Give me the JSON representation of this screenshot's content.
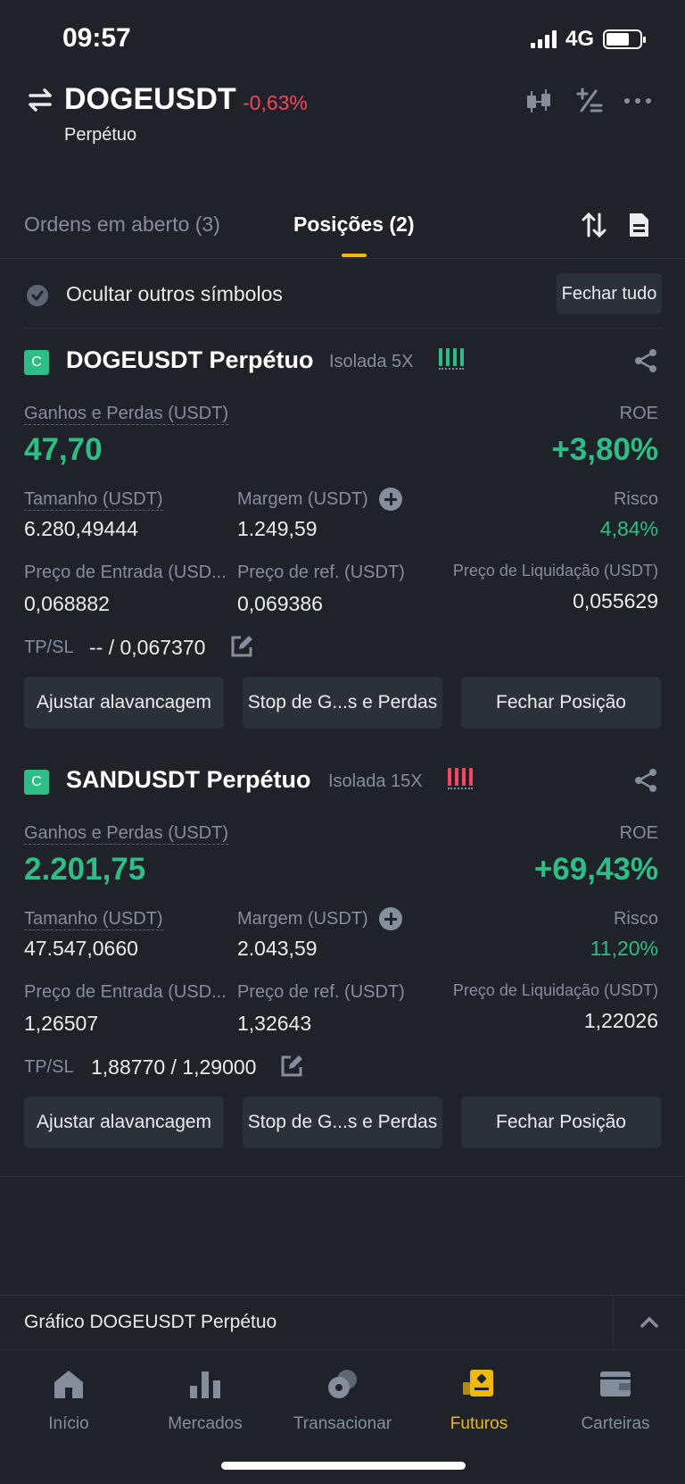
{
  "status_bar": {
    "time": "09:57",
    "network": "4G"
  },
  "header": {
    "symbol": "DOGEUSDT",
    "change": "-0,63%",
    "subtitle": "Perpétuo",
    "icons": [
      "candlestick-icon",
      "calculator-icon",
      "more-icon"
    ]
  },
  "tabs": [
    {
      "label": "Ordens em aberto (3)",
      "active": false
    },
    {
      "label": "Posições (2)",
      "active": true
    }
  ],
  "filter": {
    "label": "Ocultar outros símbolos",
    "close_all": "Fechar tudo"
  },
  "positions": [
    {
      "badge": "C",
      "title": "DOGEUSDT Perpétuo",
      "margin_mode": "Isolada 5X",
      "risk_color": "#2ebd85",
      "pnl_label": "Ganhos e Perdas (USDT)",
      "pnl": "47,70",
      "roe_label": "ROE",
      "roe": "+3,80%",
      "size_label": "Tamanho (USDT)",
      "size": "6.280,49444",
      "margin_label": "Margem (USDT)",
      "margin": "1.249,59",
      "risk_label": "Risco",
      "risk": "4,84%",
      "entry_label": "Preço de Entrada (USD...",
      "entry": "0,068882",
      "ref_label": "Preço de ref. (USDT)",
      "ref": "0,069386",
      "liq_label": "Preço de Liquidação (USDT)",
      "liq": "0,055629",
      "tpsl_label": "TP/SL",
      "tpsl": "-- / 0,067370",
      "buttons": [
        "Ajustar alavancagem",
        "Stop de G...s e Perdas",
        "Fechar Posição"
      ]
    },
    {
      "badge": "C",
      "title": "SANDUSDT Perpétuo",
      "margin_mode": "Isolada 15X",
      "risk_color": "#f6465d",
      "pnl_label": "Ganhos e Perdas (USDT)",
      "pnl": "2.201,75",
      "roe_label": "ROE",
      "roe": "+69,43%",
      "size_label": "Tamanho (USDT)",
      "size": "47.547,0660",
      "margin_label": "Margem (USDT)",
      "margin": "2.043,59",
      "risk_label": "Risco",
      "risk": "11,20%",
      "entry_label": "Preço de Entrada (USD...",
      "entry": "1,26507",
      "ref_label": "Preço de ref. (USDT)",
      "ref": "1,32643",
      "liq_label": "Preço de Liquidação (USDT)",
      "liq": "1,22026",
      "tpsl_label": "TP/SL",
      "tpsl": "1,88770 / 1,29000",
      "buttons": [
        "Ajustar alavancagem",
        "Stop de G...s e Perdas",
        "Fechar Posição"
      ]
    }
  ],
  "chart_bar": {
    "label": "Gráfico DOGEUSDT Perpétuo"
  },
  "bottom_nav": [
    {
      "label": "Início",
      "icon": "home-icon",
      "active": false
    },
    {
      "label": "Mercados",
      "icon": "markets-icon",
      "active": false
    },
    {
      "label": "Transacionar",
      "icon": "trade-icon",
      "active": false
    },
    {
      "label": "Futuros",
      "icon": "futures-icon",
      "active": true
    },
    {
      "label": "Carteiras",
      "icon": "wallet-icon",
      "active": false
    }
  ],
  "colors": {
    "accent": "#f0b90b",
    "up": "#2ebd85",
    "down": "#f6465d",
    "bg": "#1f2329"
  }
}
